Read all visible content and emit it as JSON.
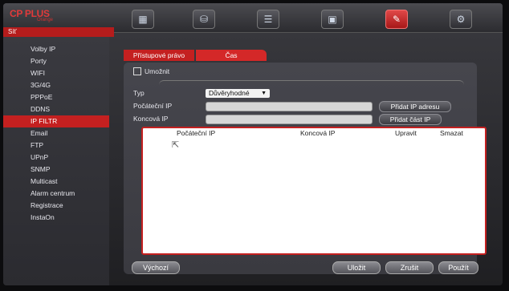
{
  "brand": {
    "logo": "CP PLUS",
    "sub": "Orange"
  },
  "nav_icons": [
    {
      "name": "camera-icon"
    },
    {
      "name": "network-icon"
    },
    {
      "name": "storage-icon"
    },
    {
      "name": "record-icon"
    },
    {
      "name": "tools-icon"
    },
    {
      "name": "settings-icon"
    }
  ],
  "sidebar": {
    "title": "Síť",
    "items": [
      {
        "label": "Volby IP"
      },
      {
        "label": "Porty"
      },
      {
        "label": "WIFI"
      },
      {
        "label": "3G/4G"
      },
      {
        "label": "PPPoE"
      },
      {
        "label": "DDNS"
      },
      {
        "label": "IP FILTR",
        "active": true
      },
      {
        "label": "Email"
      },
      {
        "label": "FTP"
      },
      {
        "label": "UPnP"
      },
      {
        "label": "SNMP"
      },
      {
        "label": "Multicast"
      },
      {
        "label": "Alarm centrum"
      },
      {
        "label": "Registrace"
      },
      {
        "label": "InstaOn"
      }
    ]
  },
  "tabs": {
    "tab1": "Přístupové právo",
    "tab2": "Čas"
  },
  "form": {
    "enable_label": "Umožnit",
    "type_label": "Typ",
    "type_value": "Důvěryhodné",
    "start_ip_label": "Počáteční IP",
    "end_ip_label": "Koncová IP",
    "add_ip_button": "Přidat IP adresu",
    "add_part_button": "Přidat část IP"
  },
  "table": {
    "headers": [
      "Počáteční IP",
      "Koncová IP",
      "Upravit",
      "Smazat"
    ]
  },
  "footer": {
    "default_button": "Výchozí",
    "save_button": "Uložit",
    "cancel_button": "Zrušit",
    "apply_button": "Použít"
  },
  "colors": {
    "accent": "#c42020"
  }
}
